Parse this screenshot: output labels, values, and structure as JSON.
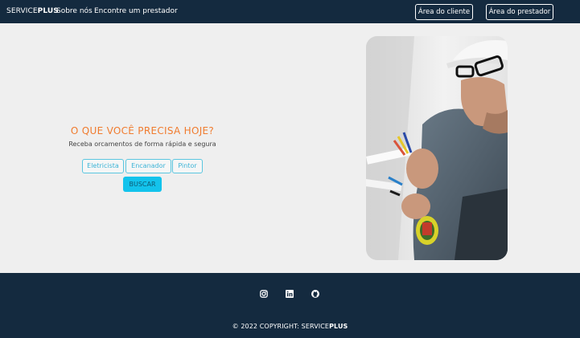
{
  "navbar": {
    "brand_prefix": "SERVICE",
    "brand_suffix": "PLUS",
    "links": [
      "Sobre nós",
      "Encontre um prestador"
    ],
    "client_button": "Área do cliente",
    "provider_button": "Área do prestador",
    "background": "#142a3f"
  },
  "hero": {
    "title": "O QUE VOCÊ PRECISA HOJE?",
    "subtitle": "Receba orcamentos de forma rápida e segura",
    "categories": [
      "Eletricista",
      "Encanador",
      "Pintor"
    ],
    "search_button": "BUSCAR",
    "title_color": "#f07b2e",
    "accent": "#13c3ec"
  },
  "photo": {
    "subject": "electrician-with-wires-and-tape"
  },
  "footer": {
    "social_icons": [
      "instagram-icon",
      "linkedin-icon",
      "github-icon"
    ],
    "copyright_prefix": "© 2022 COPYRIGHT: SERVICE",
    "copyright_suffix": "PLUS"
  }
}
